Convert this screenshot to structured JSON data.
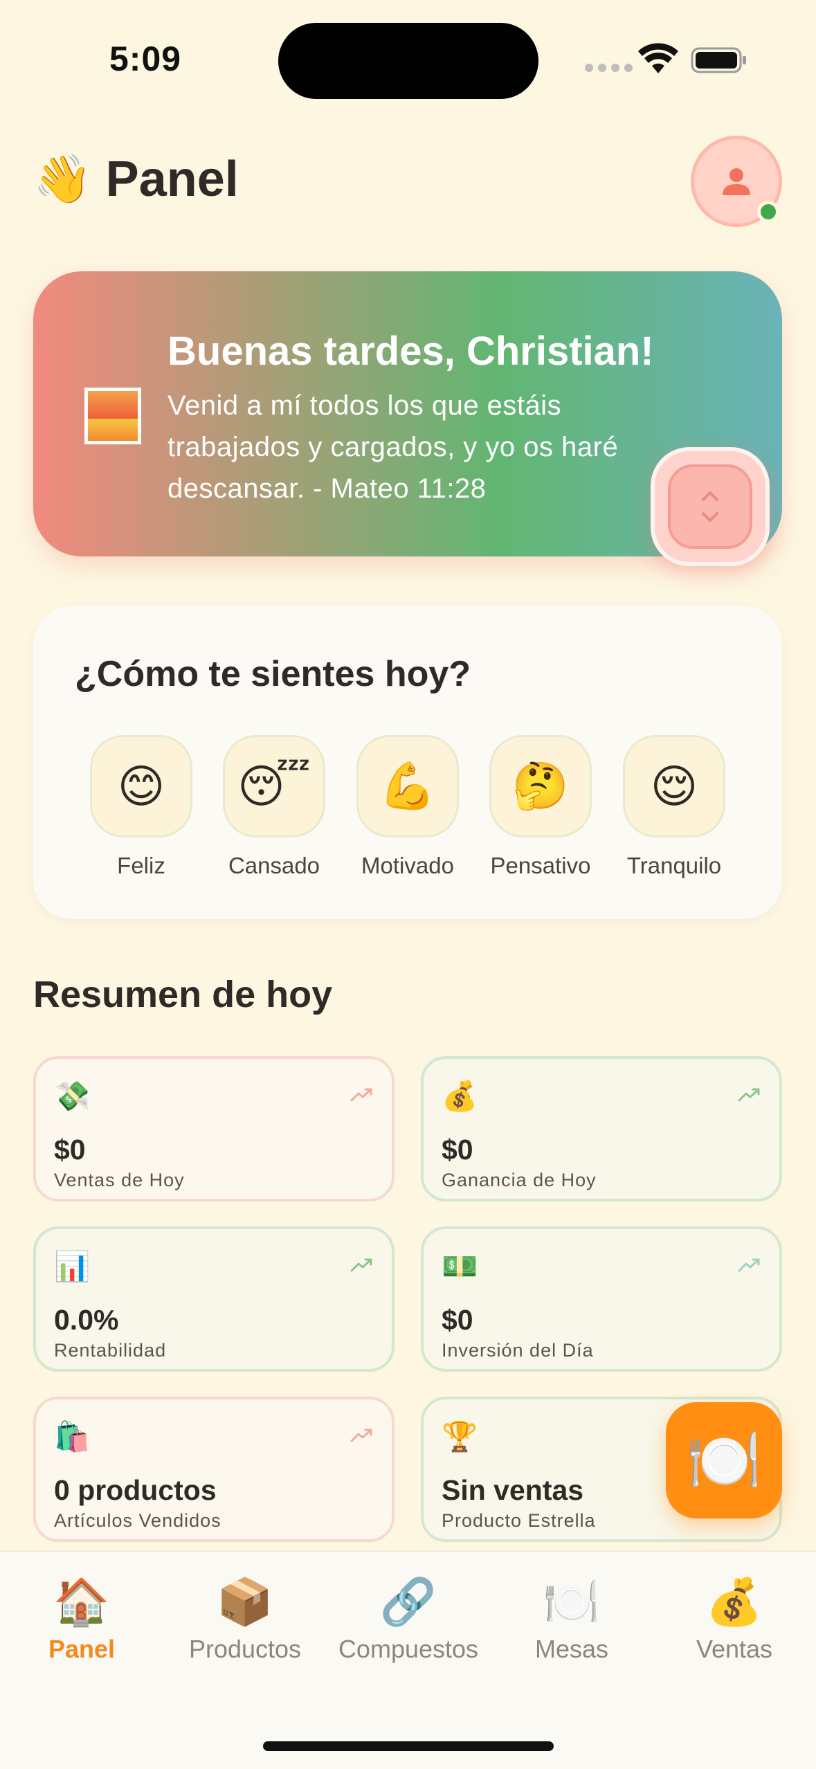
{
  "status_bar": {
    "time": "5:09"
  },
  "header": {
    "wave_emoji": "👋",
    "title": "Panel",
    "avatar_icon": "person-icon"
  },
  "greeting": {
    "title": "Buenas tardes, Christian!",
    "verse": "Venid a mí todos los que estáis trabajados y cargados, y yo os haré descansar. - Mateo 11:28",
    "image_icon": "sunrise-icon"
  },
  "mood": {
    "title": "¿Cómo te sientes hoy?",
    "options": [
      {
        "emoji": "😊",
        "label": "Feliz"
      },
      {
        "emoji": "😴",
        "label": "Cansado"
      },
      {
        "emoji": "💪",
        "label": "Motivado"
      },
      {
        "emoji": "🤔",
        "label": "Pensativo"
      },
      {
        "emoji": "😌",
        "label": "Tranquilo"
      }
    ]
  },
  "summary": {
    "title": "Resumen de hoy",
    "stats": [
      {
        "icon": "💸",
        "value": "$0",
        "label": "Ventas de Hoy",
        "accent": "#f4a99a"
      },
      {
        "icon": "💰",
        "value": "$0",
        "label": "Ganancia de Hoy",
        "accent": "#8fc48c"
      },
      {
        "icon": "📊",
        "value": "0.0%",
        "label": "Rentabilidad",
        "accent": "#8fc48c"
      },
      {
        "icon": "💵",
        "value": "$0",
        "label": "Inversión del Día",
        "accent": "#9fd0c0"
      },
      {
        "icon": "🛍️",
        "value": "0 productos",
        "label": "Artículos Vendidos",
        "accent": "#f4a99a"
      },
      {
        "icon": "🏆",
        "value": "Sin ventas",
        "label": "Producto Estrella",
        "accent": "#8fc48c"
      }
    ]
  },
  "fab": {
    "icon": "🍽️"
  },
  "tabbar": {
    "tabs": [
      {
        "icon": "🏠",
        "label": "Panel"
      },
      {
        "icon": "📦",
        "label": "Productos"
      },
      {
        "icon": "🔗",
        "label": "Compuestos"
      },
      {
        "icon": "🍽️",
        "label": "Mesas"
      },
      {
        "icon": "💰",
        "label": "Ventas"
      }
    ]
  },
  "colors": {
    "background": "#fdf6e1",
    "accent": "#f48a1e",
    "online": "#3fa84a"
  }
}
